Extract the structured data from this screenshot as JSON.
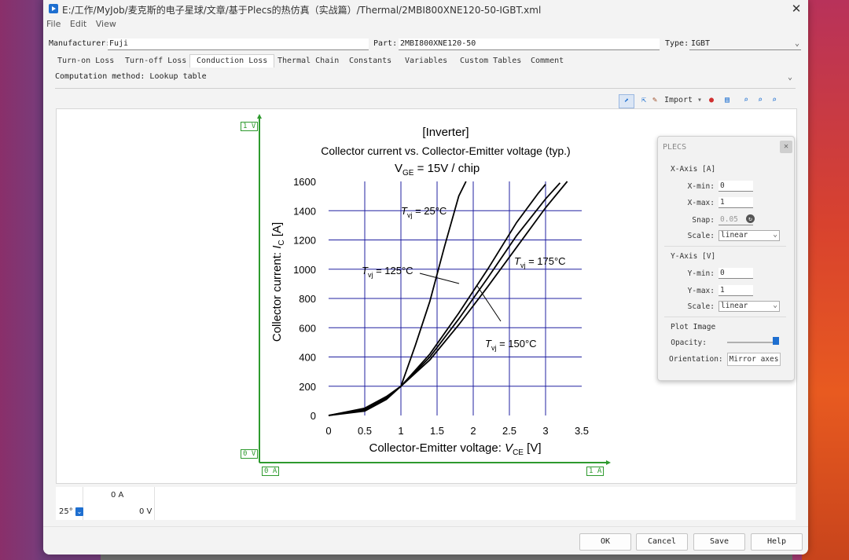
{
  "window": {
    "title": "E:/工作/MyJob/麦克斯的电子星球/文章/基于Plecs的热仿真（实战篇）/Thermal/2MBI800XNE120-50-IGBT.xml",
    "close_icon": "close-icon"
  },
  "menu": [
    "File",
    "Edit",
    "View"
  ],
  "header": {
    "manufacturer_label": "Manufacturer:",
    "manufacturer_value": "Fuji",
    "part_label": "Part:",
    "part_value": "2MBI800XNE120-50",
    "type_label": "Type:",
    "type_value": "IGBT"
  },
  "tabs": [
    "Turn-on Loss",
    "Turn-off Loss",
    "Conduction Loss",
    "Thermal Chain",
    "Constants",
    "Variables",
    "Custom Tables",
    "Comment"
  ],
  "active_tab": "Conduction Loss",
  "method": {
    "label": "Computation method:",
    "value": "Lookup table"
  },
  "toolbar": {
    "import_label": "Import"
  },
  "canvas": {
    "y_top": "1 V",
    "y_bottom": "0 V",
    "x_left": "0 A",
    "x_right": "1 A"
  },
  "bottom": {
    "current_header": "0 A",
    "temp": "25°",
    "voltage": "0 V"
  },
  "buttons": {
    "ok": "OK",
    "cancel": "Cancel",
    "save": "Save",
    "help": "Help"
  },
  "colors": {
    "accent": "#1e6fd0",
    "axis_green": "#2e9a2e",
    "grid_blue": "#2020a0"
  },
  "dialog": {
    "title": "PLECS",
    "xaxis": "X-Axis [A]",
    "xmin_label": "X-min:",
    "xmin": "0",
    "xmax_label": "X-max:",
    "xmax": "1",
    "snap_label": "Snap:",
    "snap": "0.05",
    "scale_label": "Scale:",
    "scale": "linear",
    "yaxis": "Y-Axis [V]",
    "ymin_label": "Y-min:",
    "ymin": "0",
    "ymax_label": "Y-max:",
    "ymax": "1",
    "yscale": "linear",
    "plot_image": "Plot Image",
    "opacity_label": "Opacity:",
    "opacity": 1.0,
    "orientation_label": "Orientation:",
    "orientation_btn": "Mirror axes"
  },
  "chart_data": {
    "type": "line",
    "title": "[Inverter]",
    "subtitle": "Collector current vs. Collector-Emitter voltage (typ.)",
    "condition_main": "V",
    "condition_sub": "GE",
    "condition_rest": "= 15V / chip",
    "xlabel_main": "Collector-Emitter voltage: ",
    "xlabel_var": "V",
    "xlabel_sub": "CE",
    "xlabel_unit": " [V]",
    "ylabel_main": "Collector current: ",
    "ylabel_var": "I",
    "ylabel_sub": "C",
    "ylabel_unit": " [A]",
    "xlim": [
      0,
      3.5
    ],
    "ylim": [
      0,
      1600
    ],
    "xticks": [
      "0",
      "0.5",
      "1",
      "1.5",
      "2",
      "2.5",
      "3",
      "3.5"
    ],
    "yticks": [
      "0",
      "200",
      "400",
      "600",
      "800",
      "1000",
      "1200",
      "1400",
      "1600"
    ],
    "series": [
      {
        "name_prefix": "T",
        "name_sub": "vj",
        "name": "= 25°C",
        "points": [
          [
            0,
            0
          ],
          [
            0.5,
            30
          ],
          [
            0.8,
            110
          ],
          [
            1.0,
            200
          ],
          [
            1.2,
            480
          ],
          [
            1.4,
            780
          ],
          [
            1.6,
            1150
          ],
          [
            1.8,
            1500
          ],
          [
            1.9,
            1600
          ]
        ]
      },
      {
        "name_prefix": "T",
        "name_sub": "vj",
        "name": "= 125°C",
        "points": [
          [
            0,
            0
          ],
          [
            0.5,
            40
          ],
          [
            0.8,
            120
          ],
          [
            1.0,
            200
          ],
          [
            1.4,
            420
          ],
          [
            1.8,
            700
          ],
          [
            2.2,
            1000
          ],
          [
            2.6,
            1320
          ],
          [
            2.9,
            1520
          ],
          [
            3.0,
            1580
          ]
        ]
      },
      {
        "name_prefix": "T",
        "name_sub": "vj",
        "name": "= 150°C",
        "points": [
          [
            0,
            0
          ],
          [
            0.5,
            45
          ],
          [
            0.8,
            125
          ],
          [
            1.0,
            200
          ],
          [
            1.4,
            400
          ],
          [
            1.8,
            660
          ],
          [
            2.2,
            940
          ],
          [
            2.6,
            1230
          ],
          [
            3.0,
            1480
          ],
          [
            3.2,
            1590
          ]
        ]
      },
      {
        "name_prefix": "T",
        "name_sub": "vj",
        "name": "= 175°C",
        "points": [
          [
            0,
            0
          ],
          [
            0.5,
            50
          ],
          [
            0.8,
            130
          ],
          [
            1.0,
            200
          ],
          [
            1.4,
            380
          ],
          [
            1.8,
            620
          ],
          [
            2.2,
            880
          ],
          [
            2.6,
            1150
          ],
          [
            3.0,
            1420
          ],
          [
            3.3,
            1600
          ]
        ]
      }
    ]
  }
}
